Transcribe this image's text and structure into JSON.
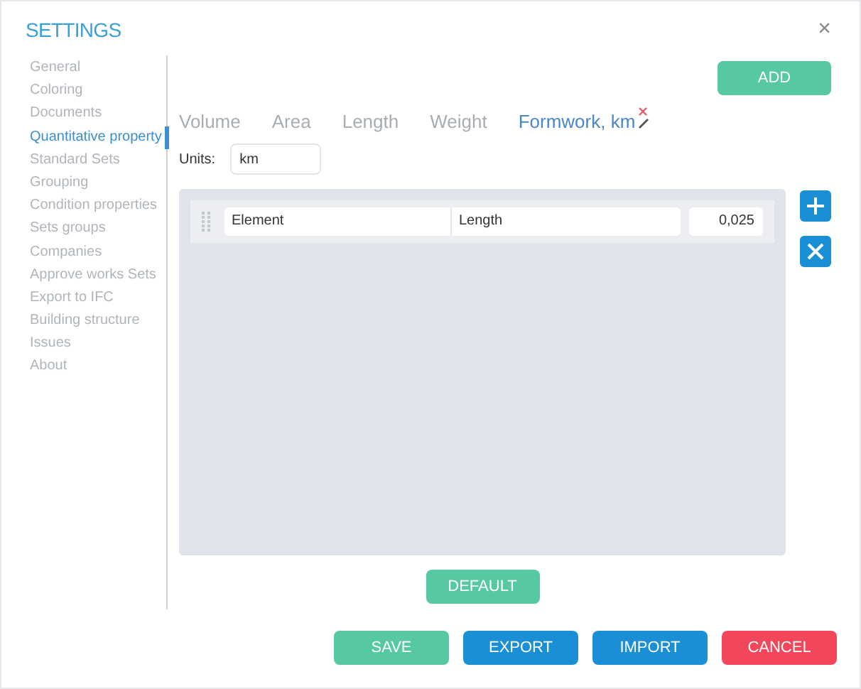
{
  "window": {
    "title": "SETTINGS",
    "close": "×"
  },
  "sidebar": {
    "items": [
      {
        "label": "General",
        "selected": false
      },
      {
        "label": "Coloring",
        "selected": false
      },
      {
        "label": "Documents",
        "selected": false
      },
      {
        "label": "Quantitative property",
        "selected": true
      },
      {
        "label": "Standard Sets",
        "selected": false
      },
      {
        "label": "Grouping",
        "selected": false
      },
      {
        "label": "Condition properties",
        "selected": false
      },
      {
        "label": "Sets groups",
        "selected": false
      },
      {
        "label": "Companies",
        "selected": false
      },
      {
        "label": "Approve works Sets",
        "selected": false
      },
      {
        "label": "Export to IFC",
        "selected": false
      },
      {
        "label": "Building structure",
        "selected": false
      },
      {
        "label": "Issues",
        "selected": false
      },
      {
        "label": "About",
        "selected": false
      }
    ]
  },
  "add_button": "ADD",
  "tabs": [
    {
      "label": "Volume",
      "selected": false
    },
    {
      "label": "Area",
      "selected": false
    },
    {
      "label": "Length",
      "selected": false
    },
    {
      "label": "Weight",
      "selected": false
    },
    {
      "label": "Formwork, km",
      "selected": true
    }
  ],
  "units": {
    "label": "Units:",
    "value": "km"
  },
  "rows": [
    {
      "element": "Element",
      "property": "Length",
      "value": "0,025"
    }
  ],
  "default_button": "DEFAULT",
  "buttons": [
    {
      "label": "SAVE",
      "kind": "green"
    },
    {
      "label": "EXPORT",
      "kind": "blue"
    },
    {
      "label": "IMPORT",
      "kind": "blue"
    },
    {
      "label": "CANCEL",
      "kind": "red"
    }
  ]
}
